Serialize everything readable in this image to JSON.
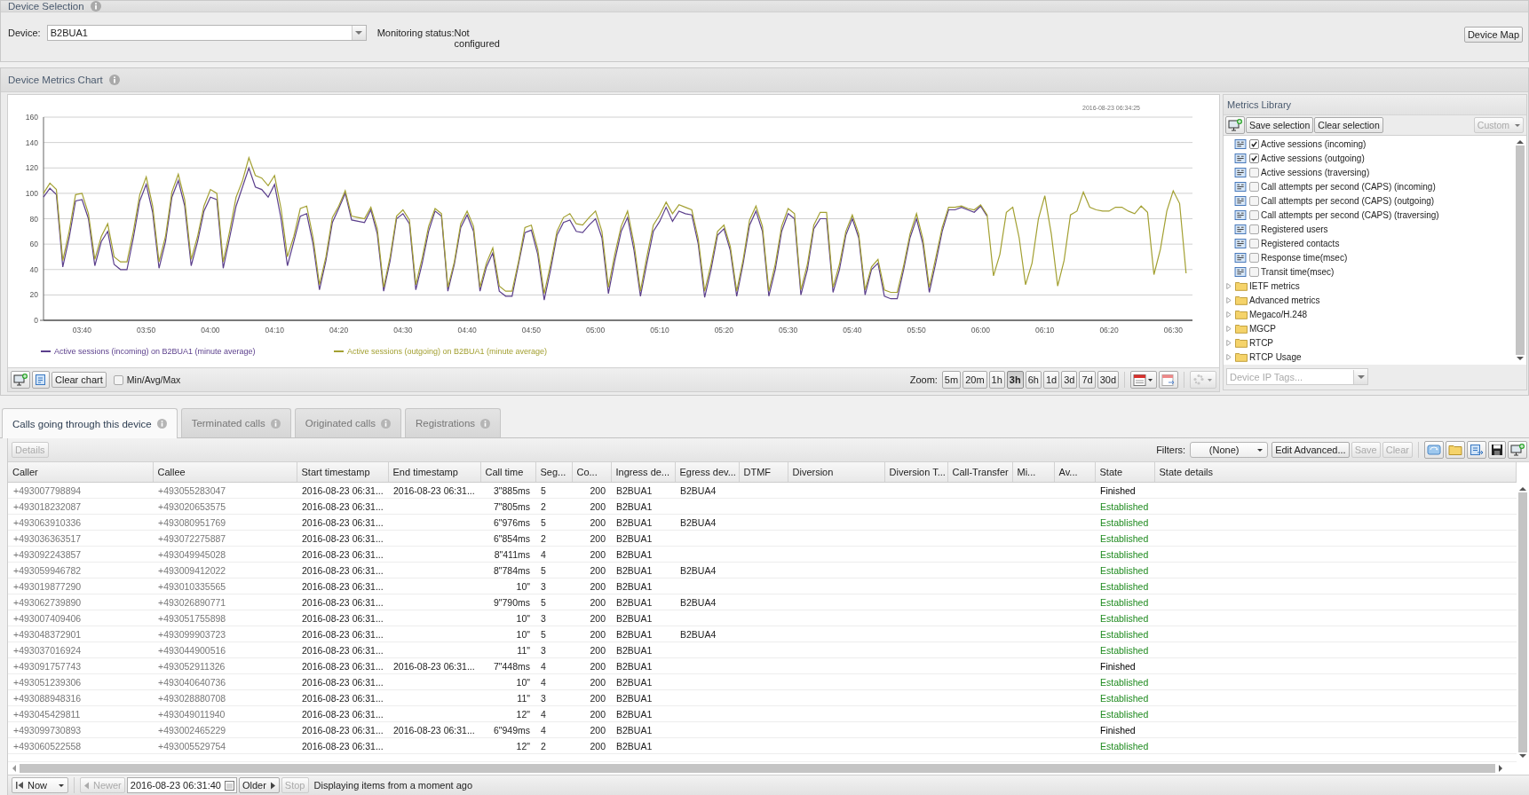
{
  "device_selection": {
    "title": "Device Selection",
    "device_label": "Device:",
    "device": "B2BUA1",
    "monitoring_label": "Monitoring status:",
    "monitoring_value": "Not configured",
    "device_map_button": "Device Map"
  },
  "metrics_chart": {
    "title": "Device Metrics Chart",
    "timestamp": "2016-08-23 06:34:25",
    "chart_data": {
      "type": "line",
      "grid": true,
      "legend": true,
      "xlim": [
        214,
        393
      ],
      "ylim": [
        0,
        160
      ],
      "yticks": [
        0,
        20,
        40,
        60,
        80,
        100,
        120,
        140,
        160
      ],
      "xticks": [
        {
          "value": 220,
          "label": "03:40"
        },
        {
          "value": 230,
          "label": "03:50"
        },
        {
          "value": 240,
          "label": "04:00"
        },
        {
          "value": 250,
          "label": "04:10"
        },
        {
          "value": 260,
          "label": "04:20"
        },
        {
          "value": 270,
          "label": "04:30"
        },
        {
          "value": 280,
          "label": "04:40"
        },
        {
          "value": 290,
          "label": "04:50"
        },
        {
          "value": 300,
          "label": "05:00"
        },
        {
          "value": 310,
          "label": "05:10"
        },
        {
          "value": 320,
          "label": "05:20"
        },
        {
          "value": 330,
          "label": "05:30"
        },
        {
          "value": 340,
          "label": "05:40"
        },
        {
          "value": 350,
          "label": "05:50"
        },
        {
          "value": 360,
          "label": "06:00"
        },
        {
          "value": 370,
          "label": "06:10"
        },
        {
          "value": 380,
          "label": "06:20"
        },
        {
          "value": 390,
          "label": "06:30"
        }
      ],
      "x": [
        214,
        215,
        216,
        217,
        218,
        219,
        220,
        221,
        222,
        223,
        224,
        225,
        226,
        227,
        228,
        229,
        230,
        231,
        232,
        233,
        234,
        235,
        236,
        237,
        238,
        239,
        240,
        241,
        242,
        243,
        244,
        245,
        246,
        247,
        248,
        249,
        250,
        251,
        252,
        253,
        254,
        255,
        256,
        257,
        258,
        259,
        260,
        261,
        262,
        263,
        264,
        265,
        266,
        267,
        268,
        269,
        270,
        271,
        272,
        273,
        274,
        275,
        276,
        277,
        278,
        279,
        280,
        281,
        282,
        283,
        284,
        285,
        286,
        287,
        288,
        289,
        290,
        291,
        292,
        293,
        294,
        295,
        296,
        297,
        298,
        299,
        300,
        301,
        302,
        303,
        304,
        305,
        306,
        307,
        308,
        309,
        310,
        311,
        312,
        313,
        314,
        315,
        316,
        317,
        318,
        319,
        320,
        321,
        322,
        323,
        324,
        325,
        326,
        327,
        328,
        329,
        330,
        331,
        332,
        333,
        334,
        335,
        336,
        337,
        338,
        339,
        340,
        341,
        342,
        343,
        344,
        345,
        346,
        347,
        348,
        349,
        350,
        351,
        352,
        353,
        354,
        355,
        356,
        357,
        358,
        359,
        360,
        361,
        362,
        363,
        364,
        365,
        366,
        367,
        368,
        369,
        370,
        371,
        372,
        373,
        374,
        375,
        376,
        377,
        378,
        379,
        380,
        381,
        382,
        383,
        384,
        385,
        386,
        387,
        388,
        389,
        390,
        391,
        392
      ],
      "series": [
        {
          "name": "Active sessions (incoming) on B2BUA1 (minute average)",
          "color": "#5b3f8c",
          "values": [
            97,
            104,
            99,
            42,
            65,
            94,
            95,
            80,
            43,
            62,
            70,
            44,
            40,
            40,
            65,
            94,
            107,
            85,
            41,
            62,
            97,
            110,
            90,
            43,
            62,
            86,
            97,
            95,
            41,
            65,
            90,
            105,
            120,
            105,
            103,
            97,
            107,
            80,
            43,
            62,
            82,
            84,
            60,
            24,
            47,
            77,
            88,
            100,
            79,
            78,
            77,
            87,
            68,
            23,
            47,
            80,
            84,
            76,
            24,
            45,
            70,
            86,
            82,
            23,
            44,
            73,
            83,
            70,
            23,
            42,
            53,
            23,
            19,
            19,
            44,
            69,
            71,
            52,
            16,
            40,
            67,
            77,
            79,
            70,
            69,
            75,
            80,
            65,
            21,
            47,
            70,
            81,
            55,
            19,
            45,
            70,
            78,
            89,
            78,
            86,
            84,
            83,
            60,
            18,
            40,
            67,
            72,
            55,
            19,
            45,
            75,
            86,
            70,
            19,
            40,
            70,
            84,
            80,
            20,
            40,
            72,
            80,
            80,
            22,
            40,
            67,
            80,
            65,
            20,
            40,
            45,
            19,
            17,
            17,
            40,
            65,
            80,
            60,
            22,
            45,
            70,
            87,
            87,
            89,
            87,
            85,
            90,
            82,
            null,
            null,
            null,
            null,
            null,
            null,
            null,
            null,
            null,
            null,
            null,
            null,
            null,
            null,
            null,
            null,
            null,
            null,
            null,
            null,
            null,
            null,
            null,
            null,
            null,
            null,
            null,
            null,
            null,
            null,
            null
          ]
        },
        {
          "name": "Active sessions (outgoing) on B2BUA1 (minute average)",
          "color": "#a3a032",
          "values": [
            100,
            108,
            103,
            47,
            70,
            99,
            100,
            84,
            48,
            66,
            76,
            50,
            46,
            46,
            70,
            99,
            113,
            90,
            46,
            66,
            101,
            115,
            95,
            48,
            66,
            90,
            103,
            100,
            46,
            70,
            97,
            110,
            128,
            114,
            112,
            106,
            114,
            88,
            50,
            66,
            88,
            90,
            65,
            28,
            50,
            81,
            90,
            102,
            82,
            81,
            80,
            89,
            72,
            26,
            50,
            82,
            87,
            79,
            28,
            49,
            74,
            88,
            84,
            26,
            46,
            76,
            86,
            74,
            26,
            45,
            57,
            27,
            23,
            23,
            46,
            73,
            75,
            56,
            21,
            44,
            70,
            81,
            84,
            76,
            75,
            81,
            86,
            70,
            26,
            52,
            74,
            86,
            60,
            23,
            50,
            75,
            83,
            93,
            84,
            91,
            89,
            87,
            64,
            23,
            44,
            70,
            75,
            58,
            23,
            48,
            79,
            90,
            74,
            23,
            44,
            74,
            88,
            84,
            24,
            44,
            75,
            85,
            85,
            26,
            44,
            70,
            83,
            68,
            24,
            42,
            48,
            24,
            22,
            22,
            43,
            68,
            84,
            64,
            26,
            49,
            73,
            89,
            89,
            90,
            88,
            87,
            91,
            83,
            35,
            52,
            85,
            89,
            65,
            28,
            45,
            80,
            98,
            68,
            27,
            47,
            83,
            86,
            101,
            89,
            87,
            86,
            86,
            89,
            89,
            86,
            84,
            90,
            85,
            36,
            56,
            86,
            102,
            92,
            37
          ]
        }
      ]
    },
    "toolbar": {
      "clear_button": "Clear chart",
      "min_avg_max": {
        "label": "Min/Avg/Max",
        "checked": false
      },
      "zoom_label": "Zoom:",
      "zoom_options": [
        {
          "label": "5m",
          "selected": false
        },
        {
          "label": "20m",
          "selected": false
        },
        {
          "label": "1h",
          "selected": false
        },
        {
          "label": "3h",
          "selected": true
        },
        {
          "label": "6h",
          "selected": false
        },
        {
          "label": "1d",
          "selected": false
        },
        {
          "label": "3d",
          "selected": false
        },
        {
          "label": "7d",
          "selected": false
        },
        {
          "label": "30d",
          "selected": false
        }
      ]
    }
  },
  "metrics_library": {
    "title": "Metrics Library",
    "save_button": "Save selection",
    "clear_button": "Clear selection",
    "custom_button": {
      "label": "Custom",
      "disabled": true
    },
    "tags_placeholder": "Device IP Tags...",
    "items": [
      {
        "kind": "metric",
        "label": "Active sessions (incoming)",
        "checked": true
      },
      {
        "kind": "metric",
        "label": "Active sessions (outgoing)",
        "checked": true
      },
      {
        "kind": "metric",
        "label": "Active sessions (traversing)",
        "checked": false
      },
      {
        "kind": "metric",
        "label": "Call attempts per second (CAPS) (incoming)",
        "checked": false
      },
      {
        "kind": "metric",
        "label": "Call attempts per second (CAPS) (outgoing)",
        "checked": false
      },
      {
        "kind": "metric",
        "label": "Call attempts per second (CAPS) (traversing)",
        "checked": false
      },
      {
        "kind": "metric",
        "label": "Registered users",
        "checked": false
      },
      {
        "kind": "metric",
        "label": "Registered contacts",
        "checked": false
      },
      {
        "kind": "metric",
        "label": "Response time(msec)",
        "checked": false
      },
      {
        "kind": "metric",
        "label": "Transit time(msec)",
        "checked": false
      },
      {
        "kind": "folder",
        "label": "IETF metrics",
        "expanded": false
      },
      {
        "kind": "folder",
        "label": "Advanced metrics",
        "expanded": false
      },
      {
        "kind": "folder",
        "label": "Megaco/H.248",
        "expanded": false
      },
      {
        "kind": "folder",
        "label": "MGCP",
        "expanded": false
      },
      {
        "kind": "folder",
        "label": "RTCP",
        "expanded": false
      },
      {
        "kind": "folder",
        "label": "RTCP Usage",
        "expanded": false
      }
    ]
  },
  "tabs": [
    {
      "label": "Calls going through this device",
      "selected": true
    },
    {
      "label": "Terminated calls",
      "selected": false
    },
    {
      "label": "Originated calls",
      "selected": false
    },
    {
      "label": "Registrations",
      "selected": false
    }
  ],
  "calls_grid": {
    "details_button": {
      "label": "Details",
      "disabled": true
    },
    "filters_label": "Filters:",
    "filter_value": "(None)",
    "buttons": [
      {
        "label": "Edit Advanced...",
        "disabled": false
      },
      {
        "label": "Save",
        "disabled": true
      },
      {
        "label": "Clear",
        "disabled": true
      }
    ],
    "columns": [
      "Caller",
      "Callee",
      "Start timestamp",
      "End timestamp",
      "Call time",
      "Seg...",
      "Co...",
      "Ingress de...",
      "Egress dev...",
      "DTMF",
      "Diversion",
      "Diversion T...",
      "Call-Transfer",
      "Mi...",
      "Av...",
      "State",
      "State details"
    ],
    "rows": [
      {
        "caller": "+493007798894",
        "callee": "+493055283047",
        "start": "2016-08-23 06:31...",
        "end": "2016-08-23 06:31...",
        "call_time": "3\"885ms",
        "seg": "5",
        "code": "200",
        "ingress": "B2BUA1",
        "egress": "B2BUA4",
        "state": "Finished",
        "color": "#000000"
      },
      {
        "caller": "+493018232087",
        "callee": "+493020653575",
        "start": "2016-08-23 06:31...",
        "call_time": "7\"805ms",
        "seg": "2",
        "code": "200",
        "ingress": "B2BUA1",
        "state": "Established",
        "color": "#1e8a1e"
      },
      {
        "caller": "+493063910336",
        "callee": "+493080951769",
        "start": "2016-08-23 06:31...",
        "call_time": "6\"976ms",
        "seg": "5",
        "code": "200",
        "ingress": "B2BUA1",
        "egress": "B2BUA4",
        "state": "Established",
        "color": "#1e8a1e"
      },
      {
        "caller": "+493036363517",
        "callee": "+493072275887",
        "start": "2016-08-23 06:31...",
        "call_time": "6\"854ms",
        "seg": "2",
        "code": "200",
        "ingress": "B2BUA1",
        "state": "Established",
        "color": "#1e8a1e"
      },
      {
        "caller": "+493092243857",
        "callee": "+493049945028",
        "start": "2016-08-23 06:31...",
        "call_time": "8\"411ms",
        "seg": "4",
        "code": "200",
        "ingress": "B2BUA1",
        "state": "Established",
        "color": "#1e8a1e"
      },
      {
        "caller": "+493059946782",
        "callee": "+493009412022",
        "start": "2016-08-23 06:31...",
        "call_time": "8\"784ms",
        "seg": "5",
        "code": "200",
        "ingress": "B2BUA1",
        "egress": "B2BUA4",
        "state": "Established",
        "color": "#1e8a1e"
      },
      {
        "caller": "+493019877290",
        "callee": "+493010335565",
        "start": "2016-08-23 06:31...",
        "call_time": "10\"",
        "seg": "3",
        "code": "200",
        "ingress": "B2BUA1",
        "state": "Established",
        "color": "#1e8a1e"
      },
      {
        "caller": "+493062739890",
        "callee": "+493026890771",
        "start": "2016-08-23 06:31...",
        "call_time": "9\"790ms",
        "seg": "5",
        "code": "200",
        "ingress": "B2BUA1",
        "egress": "B2BUA4",
        "state": "Established",
        "color": "#1e8a1e"
      },
      {
        "caller": "+493007409406",
        "callee": "+493051755898",
        "start": "2016-08-23 06:31...",
        "call_time": "10\"",
        "seg": "3",
        "code": "200",
        "ingress": "B2BUA1",
        "state": "Established",
        "color": "#1e8a1e"
      },
      {
        "caller": "+493048372901",
        "callee": "+493099903723",
        "start": "2016-08-23 06:31...",
        "call_time": "10\"",
        "seg": "5",
        "code": "200",
        "ingress": "B2BUA1",
        "egress": "B2BUA4",
        "state": "Established",
        "color": "#1e8a1e"
      },
      {
        "caller": "+493037016924",
        "callee": "+493044900516",
        "start": "2016-08-23 06:31...",
        "call_time": "11\"",
        "seg": "3",
        "code": "200",
        "ingress": "B2BUA1",
        "state": "Established",
        "color": "#1e8a1e"
      },
      {
        "caller": "+493091757743",
        "callee": "+493052911326",
        "start": "2016-08-23 06:31...",
        "end": "2016-08-23 06:31...",
        "call_time": "7\"448ms",
        "seg": "4",
        "code": "200",
        "ingress": "B2BUA1",
        "state": "Finished",
        "color": "#000000"
      },
      {
        "caller": "+493051239306",
        "callee": "+493040640736",
        "start": "2016-08-23 06:31...",
        "call_time": "10\"",
        "seg": "4",
        "code": "200",
        "ingress": "B2BUA1",
        "state": "Established",
        "color": "#1e8a1e"
      },
      {
        "caller": "+493088948316",
        "callee": "+493028880708",
        "start": "2016-08-23 06:31...",
        "call_time": "11\"",
        "seg": "3",
        "code": "200",
        "ingress": "B2BUA1",
        "state": "Established",
        "color": "#1e8a1e"
      },
      {
        "caller": "+493045429811",
        "callee": "+493049011940",
        "start": "2016-08-23 06:31...",
        "call_time": "12\"",
        "seg": "4",
        "code": "200",
        "ingress": "B2BUA1",
        "state": "Established",
        "color": "#1e8a1e"
      },
      {
        "caller": "+493099730893",
        "callee": "+493002465229",
        "start": "2016-08-23 06:31...",
        "end": "2016-08-23 06:31...",
        "call_time": "6\"949ms",
        "seg": "4",
        "code": "200",
        "ingress": "B2BUA1",
        "state": "Finished",
        "color": "#000000"
      },
      {
        "caller": "+493060522558",
        "callee": "+493005529754",
        "start": "2016-08-23 06:31...",
        "call_time": "12\"",
        "seg": "2",
        "code": "200",
        "ingress": "B2BUA1",
        "state": "Established",
        "color": "#1e8a1e"
      }
    ]
  },
  "paging": {
    "now": "Now",
    "newer": {
      "label": "Newer",
      "disabled": true
    },
    "date": "2016-08-23 06:31:40",
    "older": {
      "label": "Older",
      "disabled": false
    },
    "stop": {
      "label": "Stop",
      "disabled": true
    },
    "status": "Displaying items from a moment ago"
  }
}
